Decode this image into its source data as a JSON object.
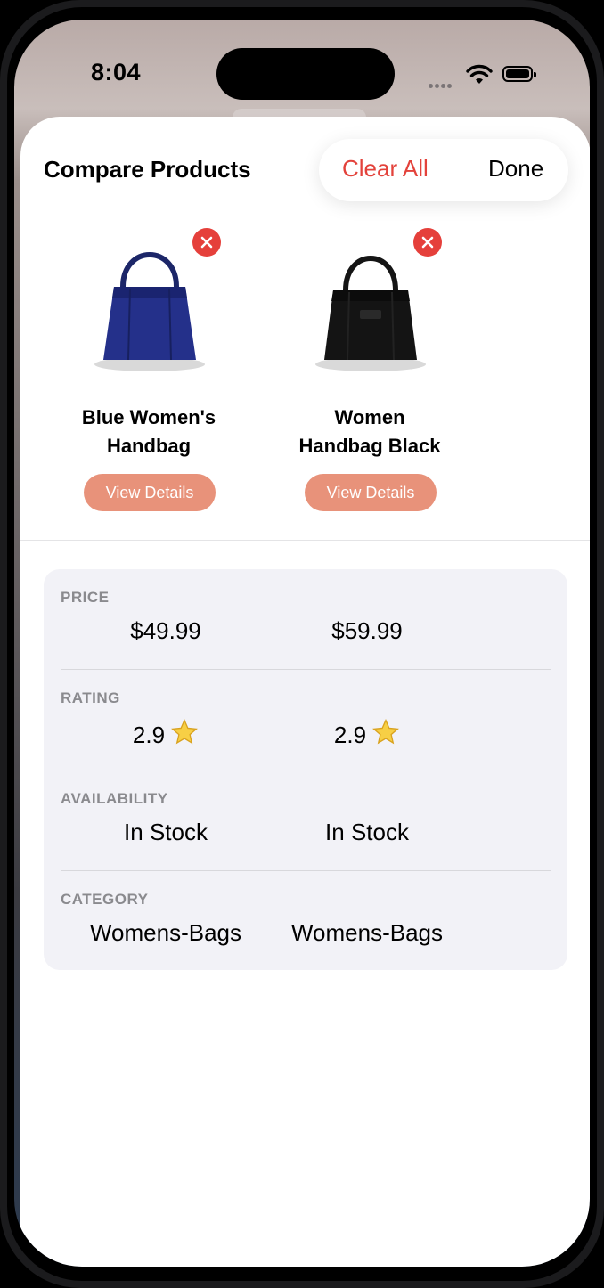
{
  "status_bar": {
    "time": "8:04"
  },
  "sheet": {
    "title": "Compare Products",
    "clear_label": "Clear All",
    "done_label": "Done"
  },
  "products": [
    {
      "name": "Blue Women's Handbag",
      "name_lines": [
        "Blue Women's",
        "Handbag"
      ],
      "button": "View Details",
      "color": "#1f2a7a"
    },
    {
      "name": "Women Handbag Black",
      "name_lines": [
        "Women",
        "Handbag Black"
      ],
      "button": "View Details",
      "color": "#111111"
    }
  ],
  "comparison": {
    "rows": [
      {
        "label": "PRICE",
        "values": [
          "$49.99",
          "$59.99"
        ]
      },
      {
        "label": "RATING",
        "values": [
          "2.9",
          "2.9"
        ]
      },
      {
        "label": "AVAILABILITY",
        "values": [
          "In Stock",
          "In Stock"
        ]
      },
      {
        "label": "CATEGORY",
        "values": [
          "Womens-Bags",
          "Womens-Bags"
        ]
      }
    ]
  },
  "colors": {
    "accent_red": "#e3423b",
    "button_salmon": "#e8927a",
    "table_bg": "#f2f2f7"
  }
}
